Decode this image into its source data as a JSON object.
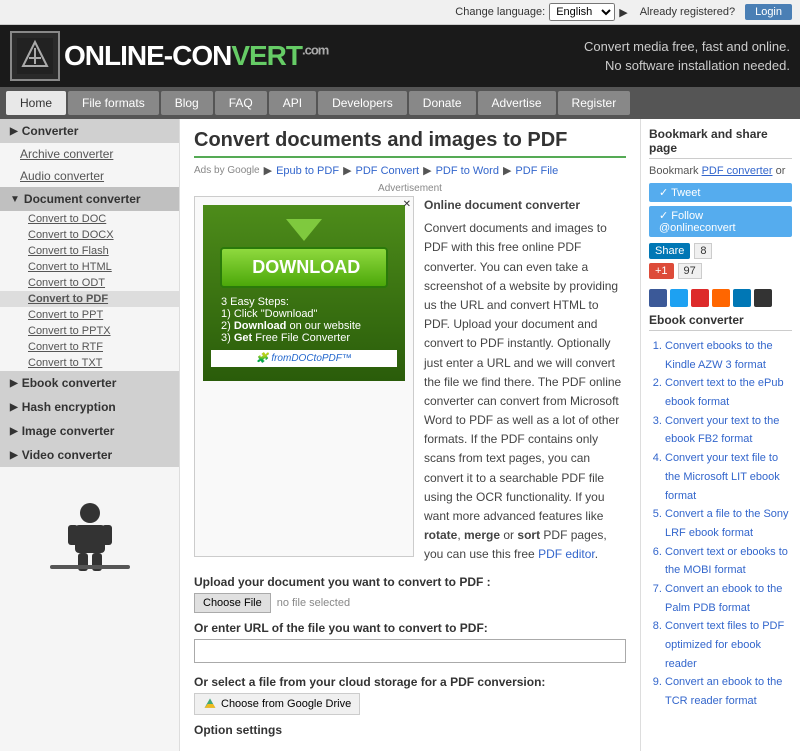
{
  "topbar": {
    "change_language": "Change language:",
    "language": "English",
    "already_registered": "Already registered?",
    "login_label": "Login"
  },
  "header": {
    "logo_text": "ONLINE-CON",
    "logo_highlight": "VERT",
    "logo_dotcom": ".com",
    "tagline1": "Convert media free, fast and online.",
    "tagline2": "No software installation needed."
  },
  "nav": {
    "items": [
      "Home",
      "File formats",
      "Blog",
      "FAQ",
      "API",
      "Developers",
      "Donate",
      "Advertise",
      "Register"
    ]
  },
  "sidebar": {
    "section_converter": "Converter",
    "items": [
      {
        "label": "Archive converter",
        "indent": false
      },
      {
        "label": "Audio converter",
        "indent": false
      },
      {
        "label": "Document converter",
        "indent": false,
        "active": true
      },
      {
        "label": "Convert to DOC",
        "indent": true
      },
      {
        "label": "Convert to DOCX",
        "indent": true
      },
      {
        "label": "Convert to Flash",
        "indent": true
      },
      {
        "label": "Convert to HTML",
        "indent": true
      },
      {
        "label": "Convert to ODT",
        "indent": true
      },
      {
        "label": "Convert to PDF",
        "indent": true,
        "active": true
      },
      {
        "label": "Convert to PPT",
        "indent": true
      },
      {
        "label": "Convert to PPTX",
        "indent": true
      },
      {
        "label": "Convert to RTF",
        "indent": true
      },
      {
        "label": "Convert to TXT",
        "indent": true
      },
      {
        "label": "Ebook converter",
        "indent": false
      },
      {
        "label": "Hash encryption",
        "indent": false
      },
      {
        "label": "Image converter",
        "indent": false
      },
      {
        "label": "Video converter",
        "indent": false
      }
    ]
  },
  "main": {
    "page_title": "Convert documents and images to PDF",
    "breadcrumb": {
      "ads_label": "Ads by Google",
      "links": [
        "Epub to PDF",
        "PDF Convert",
        "PDF to Word",
        "PDF File"
      ]
    },
    "ad": {
      "download_text": "DOWNLOAD",
      "steps": "3 Easy Steps:\n1) Click \"Download\"\n2) Download on our website\n3) Get Free File Converter",
      "footer": "fromDOCtoPDF™"
    },
    "description": "Convert documents and images to PDF with this free online PDF converter. You can even take a screenshot of a website by providing us the URL and convert HTML to PDF. Upload your document and convert to PDF instantly. Optionally just enter a URL and we will convert the file we find there. The PDF online converter can convert from Microsoft Word to PDF as well as a lot of other formats. If the PDF contains only scans from text pages, you can convert it to a searchable PDF file using the OCR functionality. If you want more advanced features like rotate, merge or sort PDF pages, you can use this free PDF editor.",
    "upload_label": "Upload your document you want to convert to PDF :",
    "choose_file": "Choose File",
    "no_file": "no file selected",
    "url_label": "Or enter URL of the file you want to convert to PDF:",
    "url_placeholder": "",
    "cloud_label": "Or select a file from your cloud storage for a PDF conversion:",
    "gdrive_label": "Choose from Google Drive",
    "option_label": "Option settings"
  },
  "right_panel": {
    "bookmark_title": "Bookmark and share page",
    "bookmark_text": "Bookmark",
    "pdf_converter": "PDF converter",
    "or_text": "or",
    "tweet_label": "✓ Tweet",
    "follow_label": "✓ Follow @onlineconvert",
    "share_label": "Share",
    "share_count": "8",
    "gplus_label": "+1",
    "gplus_count": "97",
    "ebook_title": "Ebook converter",
    "ebook_items": [
      "Convert ebooks to the Kindle AZW 3 format",
      "Convert text to the ePub ebook format",
      "Convert your text to the ebook FB2 format",
      "Convert your text file to the Microsoft LIT ebook format",
      "Convert a file to the Sony LRF ebook format",
      "Convert text or ebooks to the MOBI format",
      "Convert an ebook to the Palm PDB format",
      "Convert text files to PDF optimized for ebook reader",
      "Convert an ebook to the TCR reader format"
    ]
  }
}
